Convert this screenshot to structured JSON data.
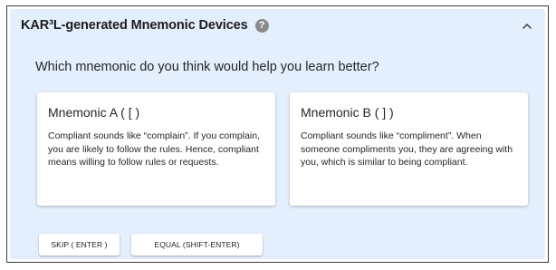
{
  "panel": {
    "title": "KAR³L-generated Mnemonic Devices",
    "help_icon_glyph": "?",
    "collapse_icon": "chevron-up-icon"
  },
  "question": "Which mnemonic do you think would help you learn better?",
  "mnemonics": [
    {
      "title": "Mnemonic A ( [ )",
      "text": "Compliant sounds like “complain”. If you complain, you are likely to follow the rules. Hence, compliant means willing to follow rules or requests."
    },
    {
      "title": "Mnemonic B ( ] )",
      "text": "Compliant sounds like “compliment”. When someone compliments you, they are agreeing with you, which is similar to being compliant."
    }
  ],
  "buttons": {
    "skip": "SKIP ( ENTER )",
    "equal": "EQUAL (SHIFT-ENTER)"
  },
  "colors": {
    "panel_background": "#e3effc",
    "card_background": "#ffffff",
    "help_icon": "#8a8a8a"
  }
}
